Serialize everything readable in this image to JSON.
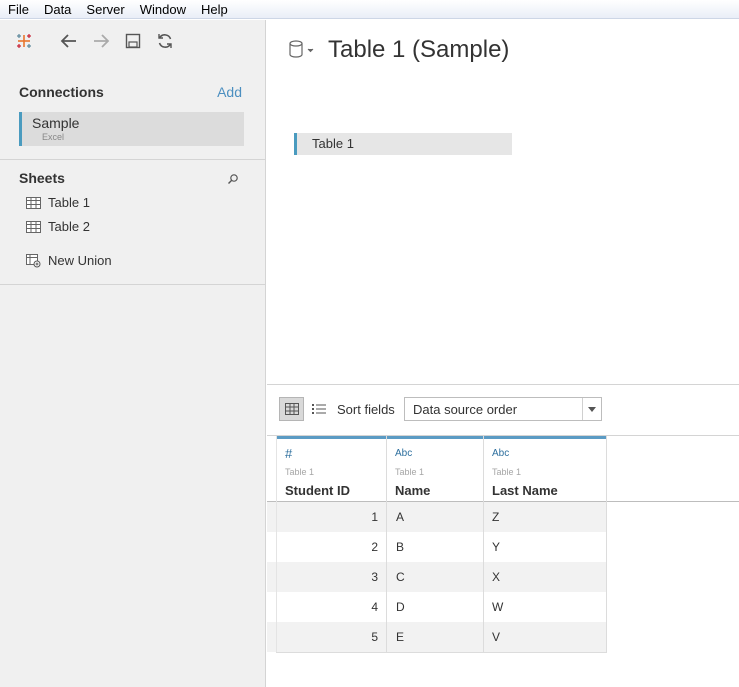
{
  "menu": [
    "File",
    "Data",
    "Server",
    "Window",
    "Help"
  ],
  "toolbar": {
    "icons": [
      "tableau-logo-icon",
      "back-arrow-icon",
      "forward-arrow-icon",
      "save-icon",
      "refresh-icon"
    ]
  },
  "connections": {
    "title": "Connections",
    "add_label": "Add",
    "items": [
      {
        "name": "Sample",
        "type": "Excel"
      }
    ]
  },
  "sheets": {
    "title": "Sheets",
    "items": [
      "Table 1",
      "Table 2"
    ],
    "new_union": "New Union"
  },
  "datasource": {
    "title": "Table 1 (Sample)",
    "canvas_table": "Table 1"
  },
  "grid_toolbar": {
    "sort_label": "Sort fields",
    "sort_value": "Data source order"
  },
  "columns": [
    {
      "type_icon": "#",
      "source": "Table 1",
      "name": "Student ID"
    },
    {
      "type_icon": "Abc",
      "source": "Table 1",
      "name": "Name"
    },
    {
      "type_icon": "Abc",
      "source": "Table 1",
      "name": "Last Name"
    }
  ],
  "rows": [
    [
      "1",
      "A",
      "Z"
    ],
    [
      "2",
      "B",
      "Y"
    ],
    [
      "3",
      "C",
      "X"
    ],
    [
      "4",
      "D",
      "W"
    ],
    [
      "5",
      "E",
      "V"
    ]
  ],
  "colors": {
    "accent": "#4a9bbf",
    "link": "#4c8fc0",
    "panel_bg": "#f0f0f0"
  }
}
